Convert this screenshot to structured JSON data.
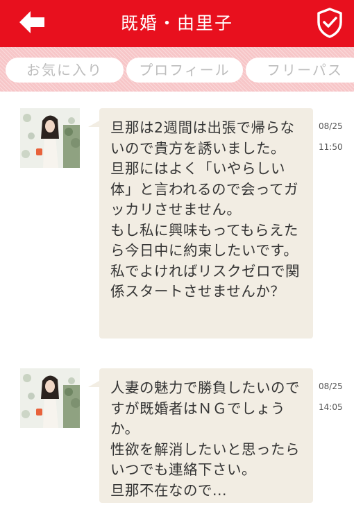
{
  "header": {
    "title": "既婚・由里子",
    "back_icon": "arrow-left-icon",
    "right_icon": "shield-check-icon",
    "color": "#e8101e"
  },
  "tabs": [
    {
      "label": "お気に入り"
    },
    {
      "label": "プロフィール"
    },
    {
      "label": "フリーパス"
    }
  ],
  "messages": [
    {
      "date": "08/25",
      "time": "11:50",
      "text": "旦那は2週間は出張で帰らないので貴方を誘いました。\n旦那にはよく「いやらしい体」と言われるので会ってガッカリさせません。\nもし私に興味もってもらえたら今日中に約束したいです。私でよければリスクゼロで関係スタートさせませんか？"
    },
    {
      "date": "08/25",
      "time": "14:05",
      "text": "人妻の魅力で勝負したいのですが既婚者はＮＧでしょうか。\n性欲を解消したいと思ったらいつでも連絡下さい。\n旦那不在なので..."
    }
  ]
}
